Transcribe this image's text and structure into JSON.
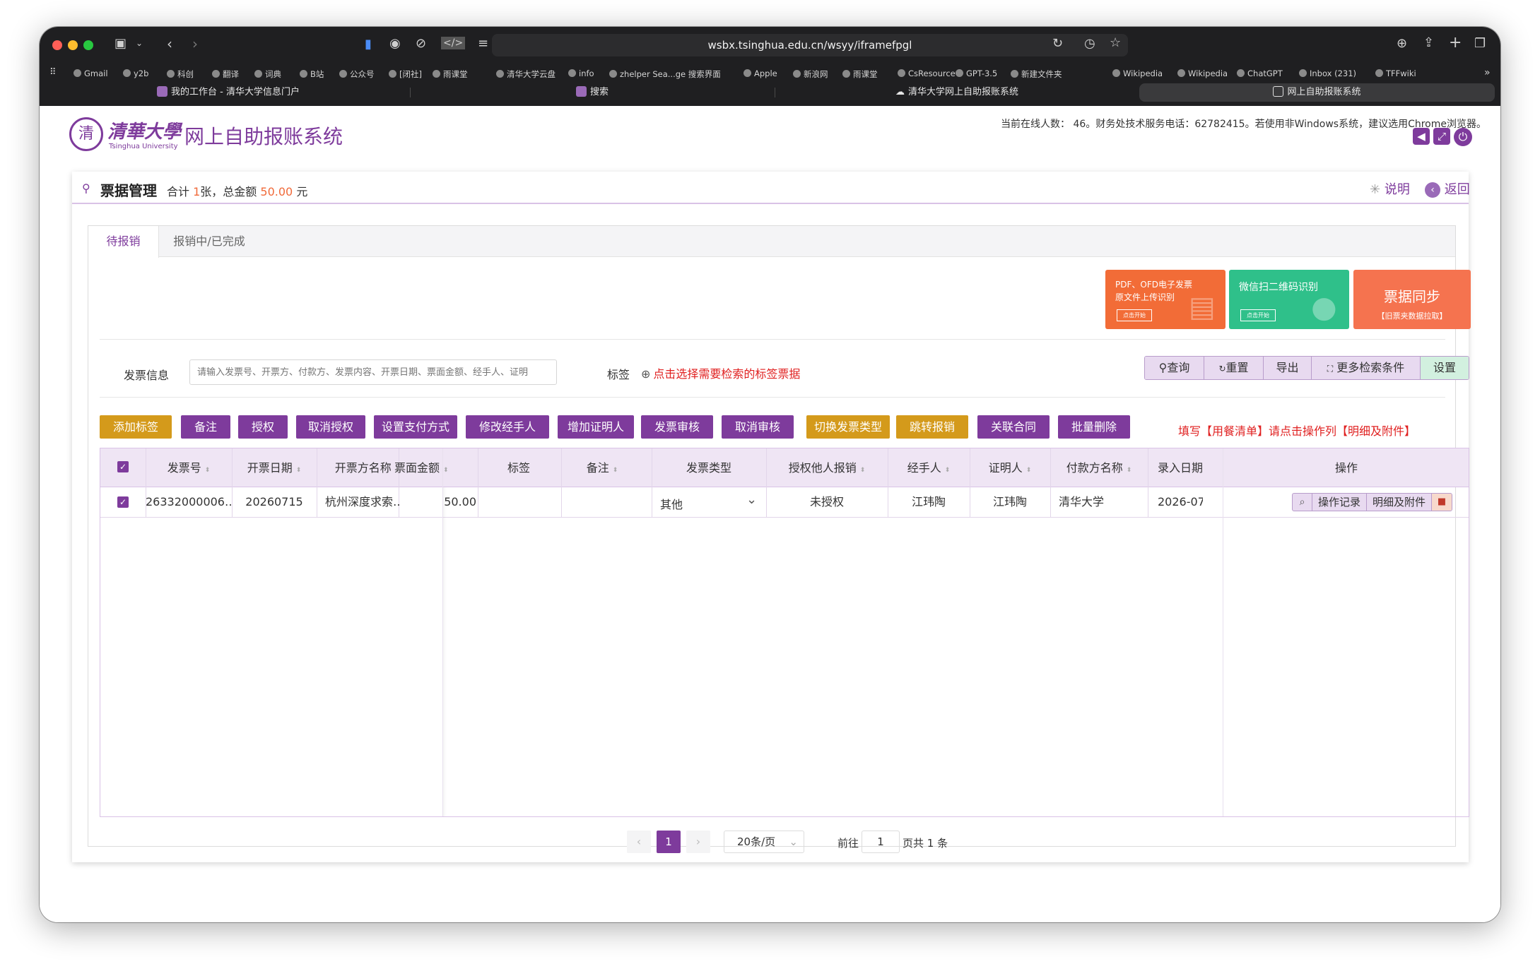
{
  "browser": {
    "url": "wsbx.tsinghua.edu.cn/wsyy/iframefpgl",
    "bookmarks": [
      "Gmail",
      "y2b",
      "科创",
      "翻译",
      "词典",
      "B站",
      "公众号",
      "[闭社]",
      "雨课堂",
      "清华大学云盘",
      "info",
      "zhelper Sea...ge 搜索界面",
      "Apple",
      "新浪网",
      "雨课堂",
      "CsResource",
      "GPT-3.5",
      "新建文件夹",
      "Wikipedia",
      "Wikipedia",
      "ChatGPT",
      "Inbox (231)",
      "TFFwiki"
    ],
    "tabs": [
      "我的工作台 - 清华大学信息门户",
      "搜索",
      "清华大学网上自助报账系统",
      "网上自助报账系统"
    ]
  },
  "header": {
    "logo_cn": "清華大學",
    "logo_en": "Tsinghua University",
    "system_title": "网上自助报账系统",
    "notice": "当前在线人数：  46。财务处技术服务电话：62782415。若使用非Windows系统，建议选用Chrome浏览器。"
  },
  "page": {
    "title": "票据管理",
    "summary_prefix": "合计",
    "summary_count": "1",
    "summary_mid": "张，总金额",
    "summary_amount": "50.00",
    "summary_suffix": "元",
    "help": "说明",
    "back": "返回"
  },
  "tabs": [
    "待报销",
    "报销中/已完成"
  ],
  "upload_cards": {
    "pdf_title_1": "PDF、OFD电子发票",
    "pdf_title_2": "原文件上传识别",
    "pdf_btn": "点击开始",
    "wechat_title": "微信扫二维码识别",
    "wechat_btn": "点击开始",
    "sync_title": "票据同步",
    "sync_sub": "【旧票夹数据拉取】"
  },
  "search": {
    "label": "发票信息",
    "placeholder": "请输入发票号、开票方、付款方、发票内容、开票日期、票面金额、经手人、证明",
    "tag_label": "标签",
    "tag_link": "点击选择需要检索的标签票据",
    "buttons": [
      "查询",
      "重置",
      "导出",
      "更多检索条件",
      "设置"
    ]
  },
  "actions": [
    "添加标签",
    "备注",
    "授权",
    "取消授权",
    "设置支付方式",
    "修改经手人",
    "增加证明人",
    "发票审核",
    "取消审核",
    "切换发票类型",
    "跳转报销",
    "关联合同",
    "批量删除"
  ],
  "hint": "填写【用餐清单】请点击操作列【明细及附件】",
  "table": {
    "headers": [
      "发票号",
      "开票日期",
      "开票方名称",
      "票面金额",
      "标签",
      "备注",
      "发票类型",
      "授权他人报销",
      "经手人",
      "证明人",
      "付款方名称",
      "录入日期",
      "操作"
    ],
    "row": {
      "invoice_no": "26332000006…",
      "date": "20260715",
      "issuer": "杭州深度求索…",
      "amount": "50.00",
      "tag": "",
      "remark": "",
      "type": "其他",
      "authorized": "未授权",
      "handler": "江玮陶",
      "witness": "江玮陶",
      "payer": "清华大学",
      "entry_date": "2026-07",
      "op_log": "操作记录",
      "op_detail": "明细及附件"
    }
  },
  "pagination": {
    "current": "1",
    "page_size": "20条/页",
    "goto_label": "前往",
    "goto_value": "1",
    "total": "页共 1 条"
  },
  "colors": {
    "purple": "#7e3b9c",
    "gold": "#d49a1b",
    "red": "#e02020",
    "orange": "#f06a3a",
    "green": "#2fc08a"
  }
}
